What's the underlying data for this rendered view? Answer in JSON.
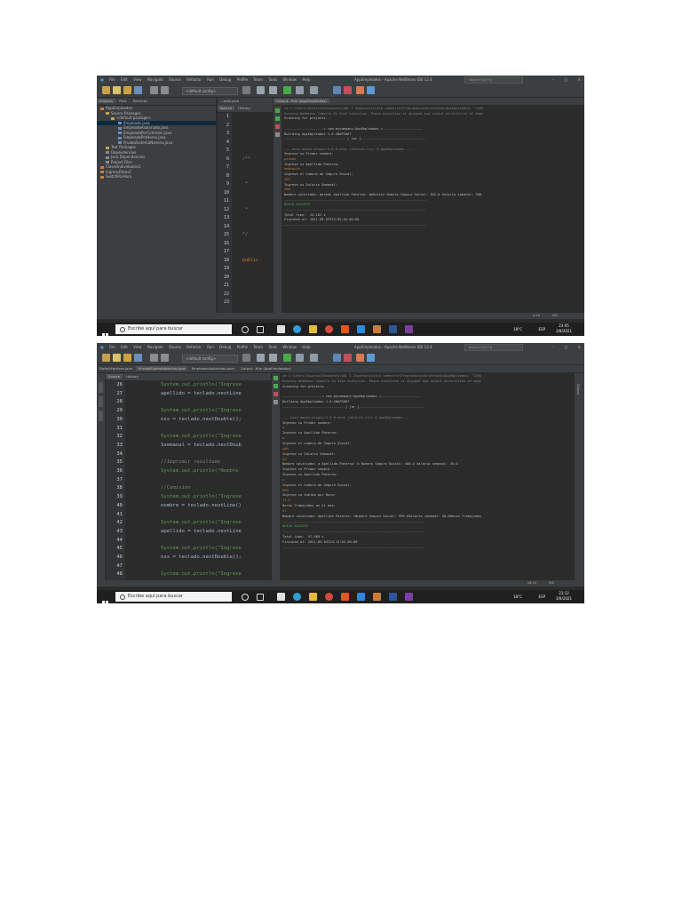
{
  "window": {
    "menu": [
      "File",
      "Edit",
      "View",
      "Navigate",
      "Source",
      "Refactor",
      "Run",
      "Debug",
      "Profile",
      "Team",
      "Tools",
      "Window",
      "Help"
    ],
    "title": "AppEmpleados - Apache NetBeans IDE 12.4",
    "search_placeholder": "Search (Ctrl+I)",
    "config": "<default config>"
  },
  "taskbar": {
    "search": "Escribe aquí para buscar",
    "temp": "18°C",
    "lang": "ESP"
  },
  "shot1": {
    "panel_tabs": [
      "Projects",
      "Files",
      "Services"
    ],
    "tree": [
      "AppEmpleados",
      "Source Packages",
      "<default package>",
      "Empleado.java",
      "EmpleadoAsalariado.java",
      "EmpleadoPorComision.java",
      "EmpleadoPorHoras.java",
      "PruebaSistemaNomina.java",
      "Test Packages",
      "Dependencies",
      "Java Dependencies",
      "Project Files",
      "ClasesIndividuales1",
      "IngresoDatos2",
      "SwitchPorHora"
    ],
    "editor_file": "...oras.java",
    "editor_tabs": [
      "Source",
      "History"
    ],
    "lines": [
      "1",
      "2",
      "3",
      "4",
      "5",
      "6",
      "7",
      "8",
      "9",
      "10",
      "11",
      "12",
      "13",
      "14",
      "15",
      "16",
      "17",
      "18",
      "19",
      "20",
      "21",
      "22",
      "23"
    ],
    "code_snippets": [
      "/**",
      " *",
      " * ",
      "public",
      "*/"
    ],
    "output_tab": "Output - Run (AppEmpleados)",
    "output": [
      "cd C:\\Users\\Usuario\\Documents\\UDL I Ingeniería\\4to semestre\\ProgramacionOrientada\\AppEmpleados; \"JAVA_",
      "Running NetBeans Compile On Save execution. Phase execution is skipped and output directories of depe",
      "Scanning for projects...",
      "",
      "--------------------< com.mycompany:AppEmpleados >--------------------",
      "Building AppEmpleados 1.0-SNAPSHOT",
      "--------------------------------[ jar ]---------------------------------",
      "",
      "--- exec-maven-plugin:3.0.0:exec (default-cli) @ AppEmpleados ---",
      "Ingrese su Primer nombre:",
      "german",
      "Ingrese su Apellido Paterno:",
      "ambrocio",
      "Ingrese el numero de Seguro Social:",
      "302",
      "Ingrese su Salario Semanal:",
      "300",
      "Nombre salariado: german Apellido Paterno: ambrocio Numero Seguro Social: 302.0 Salario semanal: 300.",
      "------------------------------------------------------------------------",
      "BUILD SUCCESS",
      "------------------------------------------------------------------------",
      "Total time:  24.162 s",
      "Finished at: 2021-09-03T23:05:04-06:00",
      "------------------------------------------------------------------------"
    ],
    "status_pos": "4:19",
    "status_ins": "INS",
    "time": "23:05",
    "date": "3/9/2021"
  },
  "shot2": {
    "tabs": [
      "SwitchPorHora.java",
      "PruebaSistemaNomina.java",
      "EmpleadoAsalariado.java",
      "Output - Run (AppEmpleados)"
    ],
    "editor_tabs": [
      "Source",
      "History"
    ],
    "lines": [
      "26",
      "27",
      "28",
      "29",
      "30",
      "31",
      "32",
      "33",
      "34",
      "35",
      "36",
      "37",
      "38",
      "39",
      "40",
      "41",
      "42",
      "43",
      "44",
      "45",
      "46",
      "47",
      "48"
    ],
    "code": [
      "System.out.println(\"Ingrese",
      "apellido = teclado.nextLine",
      "",
      "System.out.println(\"Ingrese",
      "nss = teclado.nextDouble();",
      "",
      "System.out.println(\"Ingrese",
      "Ssemanal = teclado.nextDoub",
      "",
      "//Imprimir resultado",
      "System.out.println(\"Nombre ",
      "",
      "//Comision",
      "System.out.println(\"Ingrese",
      "nombre = teclado.nextLine()",
      "",
      "System.out.println(\"Ingrese",
      "apellido = teclado.nextLine",
      "",
      "System.out.println(\"Ingrese",
      "nss = teclado.nextDouble();",
      "",
      "System.out.println(\"Ingrese"
    ],
    "output": [
      "cd C:\\Users\\Usuario\\Documents\\UDL I Ingeniería\\4to semestre\\ProgramacionOrientada\\AppEmpleados; \"JAVA_",
      "Running NetBeans Compile On Save execution. Phase execution is skipped and output directories of depe",
      "Scanning for projects...",
      "",
      "--------------------< com.mycompany:AppEmpleados >--------------------",
      "Building AppEmpleados 1.0-SNAPSHOT",
      "--------------------------------[ jar ]---------------------------------",
      "",
      "--- exec-maven-plugin:3.0.0:exec (default-cli) @ AppEmpleados ---",
      "Ingrese su Primer nombre:",
      "a",
      "Ingrese su Apellido Paterno:",
      "b",
      "Ingrese el numero de Seguro Social:",
      "400",
      "Ingrese su Salario Semanal:",
      "20",
      "Nombre salariado: a Apellido Paterno: b Numero Seguro Social: 400.0 Salario semanal: 20.0",
      "Ingrese su Primer nombre:",
      "Ingrese su Apellido Paterno:",
      "c",
      "Ingrese el numero de Seguro Social:",
      "999",
      "Ingrese su Sueldo por Hora:",
      "17.5",
      "Horas Trabajadas en el mes:",
      "31",
      "Nombre salariado: Apellido Paterno: cNumero Seguro Social: 999.0Salario semanal: 50.0Horas Trabajadas",
      "------------------------------------------------------------------------",
      "BUILD SUCCESS",
      "------------------------------------------------------------------------",
      "Total time:  57.569 s",
      "Finished at: 2021-09-03T23:12:04-06:00",
      "------------------------------------------------------------------------"
    ],
    "side_label": "Output",
    "status_pos": "26:19",
    "status_ins": "INS",
    "time": "23:12",
    "date": "3/9/2021"
  }
}
